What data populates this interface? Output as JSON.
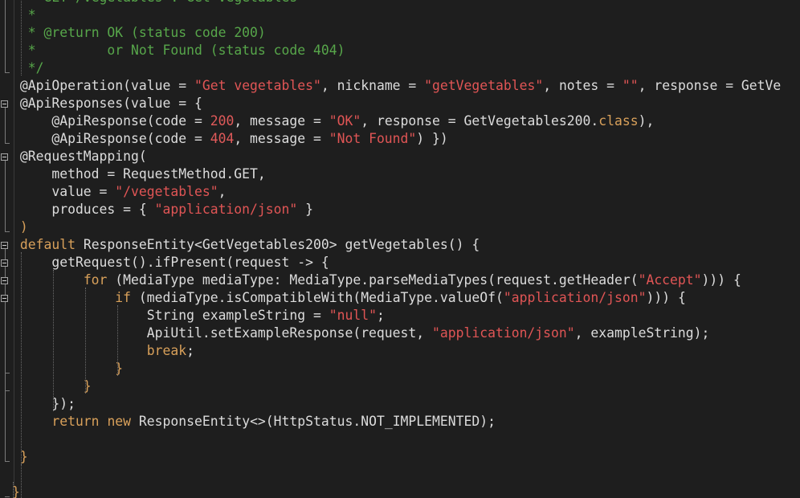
{
  "editor": {
    "lines": [
      [
        {
          "t": "  ",
          "c": "p"
        },
        {
          "t": "* GET /vegetables : Get vegetables",
          "c": "c"
        }
      ],
      [
        {
          "t": "  ",
          "c": "p"
        },
        {
          "t": "*",
          "c": "c"
        }
      ],
      [
        {
          "t": "  ",
          "c": "p"
        },
        {
          "t": "* @return OK (status code 200)",
          "c": "c"
        }
      ],
      [
        {
          "t": "  ",
          "c": "p"
        },
        {
          "t": "*         or Not Found (status code 404)",
          "c": "c"
        }
      ],
      [
        {
          "t": "  ",
          "c": "p"
        },
        {
          "t": "*/",
          "c": "c"
        }
      ],
      [
        {
          "t": " @ApiOperation(",
          "c": "p"
        },
        {
          "t": "value",
          "c": "p"
        },
        {
          "t": " = ",
          "c": "p"
        },
        {
          "t": "\"Get vegetables\"",
          "c": "s2"
        },
        {
          "t": ", nickname = ",
          "c": "p"
        },
        {
          "t": "\"getVegetables\"",
          "c": "s2"
        },
        {
          "t": ", notes = ",
          "c": "p"
        },
        {
          "t": "\"\"",
          "c": "s2"
        },
        {
          "t": ", response = GetVe",
          "c": "p"
        }
      ],
      [
        {
          "t": " @ApiResponses(value = {",
          "c": "p"
        }
      ],
      [
        {
          "t": "     @ApiResponse(code = ",
          "c": "p"
        },
        {
          "t": "200",
          "c": "num"
        },
        {
          "t": ", message = ",
          "c": "p"
        },
        {
          "t": "\"OK\"",
          "c": "s2"
        },
        {
          "t": ", response = GetVegetables200.",
          "c": "p"
        },
        {
          "t": "class",
          "c": "kw"
        },
        {
          "t": "),",
          "c": "p"
        }
      ],
      [
        {
          "t": "     @ApiResponse(code = ",
          "c": "p"
        },
        {
          "t": "404",
          "c": "num"
        },
        {
          "t": ", message = ",
          "c": "p"
        },
        {
          "t": "\"Not Found\"",
          "c": "s2"
        },
        {
          "t": ") })",
          "c": "p"
        }
      ],
      [
        {
          "t": " @RequestMapping(",
          "c": "p"
        }
      ],
      [
        {
          "t": "     method = RequestMethod.GET,",
          "c": "p"
        }
      ],
      [
        {
          "t": "     value = ",
          "c": "p"
        },
        {
          "t": "\"/vegetables\"",
          "c": "s2"
        },
        {
          "t": ",",
          "c": "p"
        }
      ],
      [
        {
          "t": "     produces = { ",
          "c": "p"
        },
        {
          "t": "\"application/json\"",
          "c": "s2"
        },
        {
          "t": " }",
          "c": "p"
        }
      ],
      [
        {
          "t": " )",
          "c": "br"
        }
      ],
      [
        {
          "t": " ",
          "c": "p"
        },
        {
          "t": "default",
          "c": "kw"
        },
        {
          "t": " ResponseEntity<GetVegetables200> getVegetables() {",
          "c": "p"
        }
      ],
      [
        {
          "t": "     getRequest().ifPresent(request -> {",
          "c": "p"
        }
      ],
      [
        {
          "t": "         ",
          "c": "p"
        },
        {
          "t": "for",
          "c": "kw"
        },
        {
          "t": " (MediaType mediaType: MediaType.parseMediaTypes(request.getHeader(",
          "c": "p"
        },
        {
          "t": "\"Accept\"",
          "c": "s2"
        },
        {
          "t": "))) {",
          "c": "p"
        }
      ],
      [
        {
          "t": "             ",
          "c": "p"
        },
        {
          "t": "if",
          "c": "kw"
        },
        {
          "t": " (mediaType.isCompatibleWith(MediaType.valueOf(",
          "c": "p"
        },
        {
          "t": "\"application/json\"",
          "c": "s2"
        },
        {
          "t": "))) {",
          "c": "p"
        }
      ],
      [
        {
          "t": "                 String exampleString = ",
          "c": "p"
        },
        {
          "t": "\"null\"",
          "c": "s2"
        },
        {
          "t": ";",
          "c": "p"
        }
      ],
      [
        {
          "t": "                 ApiUtil.setExampleResponse(request, ",
          "c": "p"
        },
        {
          "t": "\"application/json\"",
          "c": "s2"
        },
        {
          "t": ", exampleString);",
          "c": "p"
        }
      ],
      [
        {
          "t": "                 ",
          "c": "p"
        },
        {
          "t": "break",
          "c": "kw"
        },
        {
          "t": ";",
          "c": "p"
        }
      ],
      [
        {
          "t": "             }",
          "c": "br"
        }
      ],
      [
        {
          "t": "         }",
          "c": "br"
        }
      ],
      [
        {
          "t": "     });",
          "c": "p"
        }
      ],
      [
        {
          "t": "     ",
          "c": "p"
        },
        {
          "t": "return",
          "c": "kw"
        },
        {
          "t": " ",
          "c": "p"
        },
        {
          "t": "new",
          "c": "kw"
        },
        {
          "t": " ResponseEntity<>(HttpStatus.NOT_IMPLEMENTED);",
          "c": "p"
        }
      ],
      [
        {
          "t": "",
          "c": "p"
        }
      ],
      [
        {
          "t": " }",
          "c": "br"
        }
      ],
      [
        {
          "t": "",
          "c": "p"
        }
      ],
      [
        {
          "t": "}",
          "c": "br"
        }
      ]
    ]
  }
}
